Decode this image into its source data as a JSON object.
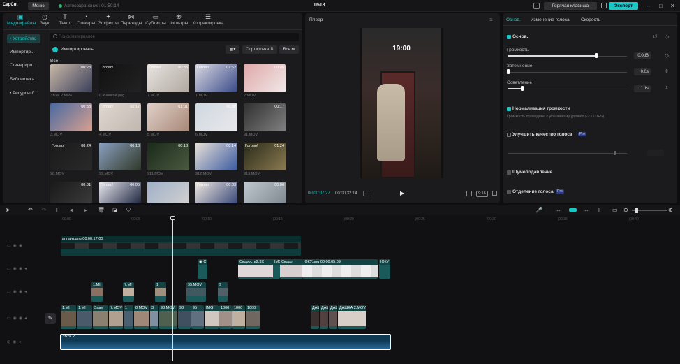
{
  "app": {
    "logo": "CapCut",
    "menu_label": "Меню",
    "autosave": "Автосохранение: 01:50:14",
    "project_title": "0518",
    "hotkey_label": "Горячая клавиша",
    "export_label": "Экспорт"
  },
  "toolbar": [
    {
      "label": "Медиафайлы",
      "icon": "media-icon"
    },
    {
      "label": "Звук",
      "icon": "audio-icon"
    },
    {
      "label": "Текст",
      "icon": "text-icon"
    },
    {
      "label": "Стикеры",
      "icon": "sticker-icon"
    },
    {
      "label": "Эффекты",
      "icon": "effects-icon"
    },
    {
      "label": "Переходы",
      "icon": "transitions-icon"
    },
    {
      "label": "Субтитры",
      "icon": "subtitles-icon"
    },
    {
      "label": "Фильтры",
      "icon": "filters-icon"
    },
    {
      "label": "Корректировка",
      "icon": "adjust-icon"
    }
  ],
  "sidebar": [
    {
      "label": "• Устройство",
      "active": true
    },
    {
      "label": "Импортир..."
    },
    {
      "label": "Сгенериро..."
    },
    {
      "label": "Библиотека"
    },
    {
      "label": "• Ресурсы б..."
    }
  ],
  "media": {
    "search_placeholder": "Поиск материалов",
    "import_label": "Импортировать",
    "sort_label": "Сортировка",
    "filter_label": "Все",
    "all_label": "Все",
    "items": [
      {
        "name": "ЗВУК 2.MP4",
        "dur": "00:28",
        "tag": "",
        "c1": "#c9b8a8",
        "c2": "#3a3f5a"
      },
      {
        "name": "С кнопкой.png",
        "dur": "",
        "tag": "Готово!",
        "c1": "#111",
        "c2": "#222"
      },
      {
        "name": "7.MOV",
        "dur": "00:35",
        "tag": "Готово!",
        "c1": "#e8e4e0",
        "c2": "#b0a8a0"
      },
      {
        "name": "1.MOV",
        "dur": "01:52",
        "tag": "Готово!",
        "c1": "#d8d8e0",
        "c2": "#3a4a8a"
      },
      {
        "name": "2.MOV",
        "dur": "00:05",
        "tag": "",
        "c1": "#e0a8a8",
        "c2": "#f0e8e8"
      },
      {
        "name": "3.MOV",
        "dur": "00:38",
        "tag": "",
        "c1": "#4a6aa0",
        "c2": "#d8a090"
      },
      {
        "name": "4.MOV",
        "dur": "00:17",
        "tag": "Готово!",
        "c1": "#e0d8d0",
        "c2": "#c0b8b0"
      },
      {
        "name": "5.MOV",
        "dur": "01:01",
        "tag": "",
        "c1": "#e0d0c8",
        "c2": "#a88878"
      },
      {
        "name": "6.MOV",
        "dur": "00:30",
        "tag": "",
        "c1": "#d0d8e0",
        "c2": "#e8e8ec"
      },
      {
        "name": "91.MOV",
        "dur": "00:17",
        "tag": "",
        "c1": "#303030",
        "c2": "#808080"
      },
      {
        "name": "98.MOV",
        "dur": "00:24",
        "tag": "Готово!",
        "c1": "#1a1a1a",
        "c2": "#2a2a2a"
      },
      {
        "name": "99.MOV",
        "dur": "00:18",
        "tag": "",
        "c1": "#8aa0c0",
        "c2": "#303828"
      },
      {
        "name": "911.MOV",
        "dur": "00:18",
        "tag": "",
        "c1": "#1a2a1a",
        "c2": "#4a5a40"
      },
      {
        "name": "912.MOV",
        "dur": "00:14",
        "tag": "",
        "c1": "#e8e0d8",
        "c2": "#3a5aa0"
      },
      {
        "name": "913.MOV",
        "dur": "01:24",
        "tag": "Готово!",
        "c1": "#2a2a1a",
        "c2": "#8a7a50"
      },
      {
        "name": "",
        "dur": "00:01",
        "tag": "",
        "c1": "#1a1a1a",
        "c2": "#3a3a3a"
      },
      {
        "name": "",
        "dur": "00:05",
        "tag": "Готово!",
        "c1": "#e8e8f0",
        "c2": "#202840"
      },
      {
        "name": "",
        "dur": "",
        "tag": "",
        "c1": "#a0b0c8",
        "c2": "#d0d0d0"
      },
      {
        "name": "",
        "dur": "00:03",
        "tag": "Готово!",
        "c1": "#f0e8e0",
        "c2": "#3a4a7a"
      },
      {
        "name": "",
        "dur": "00:06",
        "tag": "",
        "c1": "#c0c8d0",
        "c2": "#808890"
      }
    ]
  },
  "player": {
    "title": "Плеер",
    "overlay_time": "19:00",
    "time_current": "00:00:07:27",
    "time_total": "00:00:32:14",
    "ratio_label": "9:16"
  },
  "props": {
    "tabs": [
      "Основ.",
      "Изменение голоса",
      "Скорость"
    ],
    "section_label": "Основ.",
    "volume_label": "Громкость",
    "volume_value": "0.0dB",
    "volume_level": 0.74,
    "fadein_label": "Затемнение",
    "fadein_value": "0.0s",
    "fadein_level": 0,
    "fadeout_label": "Осветление",
    "fadeout_value": "1.1s",
    "fadeout_level": 0.12,
    "normalize_label": "Нормализация громкости",
    "normalize_desc": "Громкость приведена к указанному уровню (-23 LUFS)",
    "enhance_label": "Улучшить качество голоса",
    "enhance_badge": "Pro",
    "enhance_level": 0.9,
    "noise_label": "Шумоподавление",
    "voice_sep_label": "Отделение голоса",
    "voice_sep_badge": "Pro",
    "accent_color": "#1cc6c2"
  },
  "timeline": {
    "ruler": [
      "00:00",
      "|00:05",
      "|00:10",
      "|00:15",
      "|00:20",
      "|00:25",
      "|00:30",
      "|00:35",
      "|00:40"
    ],
    "sticker_clip": "аппант.png  00:00:17:00",
    "overlay_clips": [
      "Скорость2.3X",
      "IMG",
      "Скоро",
      "ЮКУ.png  00:00:05:09",
      "ЮКУ"
    ],
    "video_clips_row3": [
      "1.MI",
      "7.MI",
      "1",
      "95.MOV",
      "9"
    ],
    "main_clips": [
      "1.MI",
      "1.MI",
      "Заве",
      "7.MOV",
      "1",
      "8.MOV",
      "3",
      "93.MOV",
      "98",
      "95",
      "IMG",
      "1000",
      "1000",
      "1000",
      "ДАЩ",
      "ДАЩ",
      "ДАЩ",
      "ДАШКА 2.MOV"
    ],
    "audio_clip": "ЗВУК 2"
  }
}
